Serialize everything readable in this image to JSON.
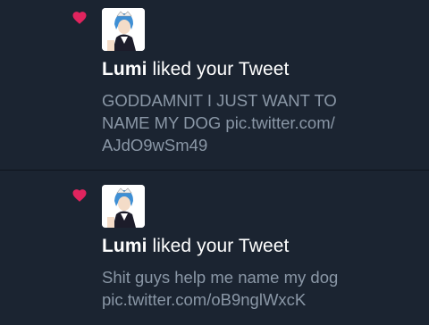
{
  "colors": {
    "background": "#1b2431",
    "heart": "#e0245e",
    "headline": "#ffffff",
    "tweet_text": "#8a97a6",
    "divider": "#0e141c"
  },
  "notifications": [
    {
      "icon": "heart-icon",
      "avatar": "user-avatar",
      "user_name": "Lumi",
      "action": " liked your Tweet",
      "tweet_text": "GODDAMNIT I JUST WANT TO\nNAME MY DOG pic.twitter.com/\nAJdO9wSm49"
    },
    {
      "icon": "heart-icon",
      "avatar": "user-avatar",
      "user_name": "Lumi",
      "action": " liked your Tweet",
      "tweet_text": "Shit guys help me name my dog\npic.twitter.com/oB9nglWxcK"
    }
  ]
}
